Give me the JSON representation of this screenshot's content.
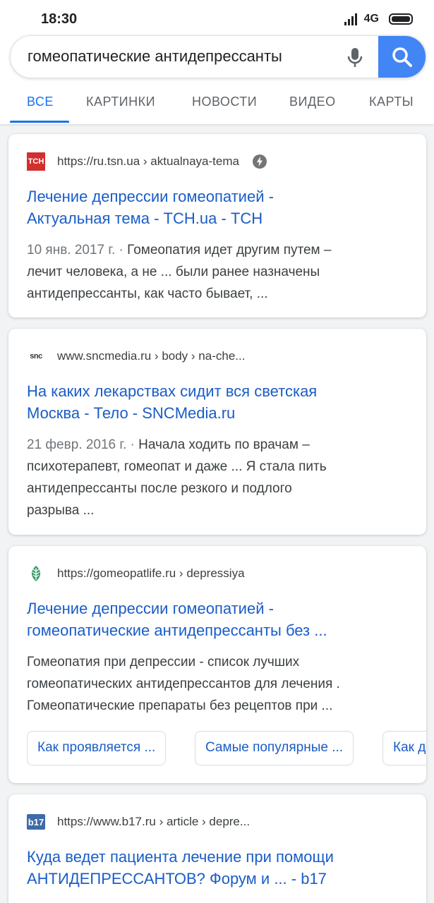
{
  "status_bar": {
    "time": "18:30",
    "network": "4G"
  },
  "search": {
    "query": "гомеопатические антидепрессанты"
  },
  "tabs": [
    {
      "label": "ВСЕ",
      "active": true
    },
    {
      "label": "КАРТИНКИ"
    },
    {
      "label": "НОВОСТИ"
    },
    {
      "label": "ВИДЕО"
    },
    {
      "label": "КАРТЫ"
    }
  ],
  "results": [
    {
      "favicon_text": "ТСН",
      "url": "https://ru.tsn.ua › aktualnaya-tema",
      "title_lines": [
        "Лечение депрессии гомеопатией -",
        "Актуальная тема - ТСН.ua - ТСН"
      ],
      "date": "10 янв. 2017 г. · ",
      "snippet_lines": [
        "Гомеопатия идет другим путем –",
        "лечит человека, а не ... были ранее назначены",
        "антидепрессанты, как часто бывает, ..."
      ]
    },
    {
      "favicon_text": "snc",
      "url": "www.sncmedia.ru › body › na-che...",
      "title_lines": [
        "На каких лекарствах сидит вся светская",
        "Москва - Тело - SNCMedia.ru"
      ],
      "date": "21 февр. 2016 г. · ",
      "snippet_lines": [
        "Начала ходить по врачам –",
        "психотерапевт, гомеопат и даже ... Я стала пить",
        "антидепрессанты после резкого и подлого",
        "разрыва ..."
      ]
    },
    {
      "url": "https://gomeopatlife.ru › depressiya",
      "title_lines": [
        "Лечение депрессии гомеопатией -",
        "гомеопатические антидепрессанты без ..."
      ],
      "snippet_lines": [
        "Гомеопатия при депрессии - список лучших",
        "гомеопатических антидепрессантов для лечения .",
        "Гомеопатические препараты без рецептов при  ..."
      ],
      "chips": [
        "Как проявляется ...",
        "Самые популярные ...",
        "Как д"
      ]
    },
    {
      "favicon_text": "b17",
      "url": "https://www.b17.ru › article › depre...",
      "title_lines": [
        "Куда ведет пациента лечение при помощи",
        "АНТИДЕПРЕССАНТОВ? Форум и ... - b17"
      ]
    }
  ],
  "colors": {
    "accent": "#1a73e8",
    "link": "#1a5dc7",
    "search_button": "#4285f4",
    "tsn_red": "#d32f2f"
  }
}
